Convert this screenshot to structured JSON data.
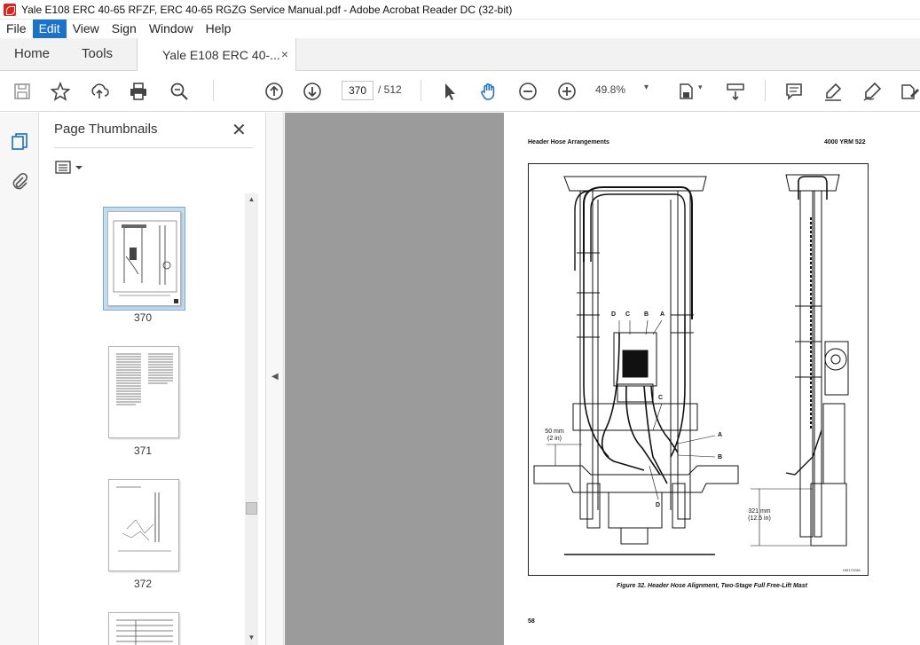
{
  "window": {
    "title": "Yale E108 ERC 40-65 RFZF, ERC 40-65 RGZG Service Manual.pdf - Adobe Acrobat Reader DC (32-bit)"
  },
  "menu": {
    "items": [
      "File",
      "Edit",
      "View",
      "Sign",
      "Window",
      "Help"
    ]
  },
  "tabs": {
    "home": "Home",
    "tools": "Tools",
    "document": "Yale E108 ERC 40-...",
    "close_symbol": "×"
  },
  "toolbar": {
    "current_page": "370",
    "total_pages": "/ 512",
    "zoom": "49.8%",
    "zoom_caret": "▾",
    "icons": [
      "save-icon",
      "bookmark-star-icon",
      "upload-icon",
      "print-icon",
      "find-zoom-icon",
      "page-up-icon",
      "page-down-icon",
      "select-arrow-icon",
      "hand-icon",
      "zoom-out-icon",
      "zoom-in-icon",
      "page-display-icon",
      "scroll-mode-icon",
      "comment-icon",
      "highlight-icon",
      "sign-icon",
      "edit-icon"
    ]
  },
  "sidebar": {
    "title": "Page Thumbnails",
    "close_symbol": "✕",
    "options_caret": "▾",
    "thumbnails": [
      {
        "label": "370",
        "selected": true
      },
      {
        "label": "371",
        "selected": false
      },
      {
        "label": "372",
        "selected": false
      }
    ]
  },
  "document": {
    "header_left": "Header Hose Arrangements",
    "header_right": "4000 YRM 522",
    "caption": "Figure 32. Header Hose Alignment, Two-Stage Full Free-Lift Mast",
    "page_number": "58",
    "callouts": {
      "d": "D",
      "c": "C",
      "b": "B",
      "a": "A",
      "c2": "C",
      "a2": "A",
      "b2": "B",
      "d2": "D",
      "dim1_line1": "50 mm",
      "dim1_line2": "(2 in)",
      "dim2_line1": "321 mm",
      "dim2_line2": "(12.5 in)",
      "drawing_id": "HM170288"
    }
  },
  "colors": {
    "menu_active": "#1a73c8",
    "doc_background": "#9b9b9b",
    "thumb_selection": "#c4dcf0"
  }
}
